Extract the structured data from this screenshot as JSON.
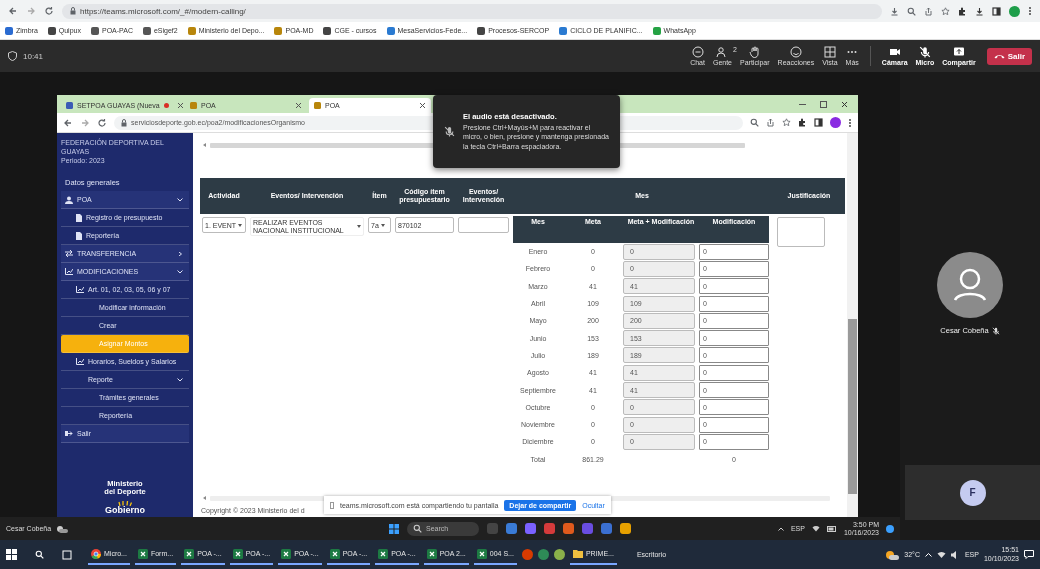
{
  "browser": {
    "url": "https://teams.microsoft.com/_#/modern-calling/",
    "bookmarks": [
      "Zimbra",
      "Quipux",
      "POA-PAC",
      "eSigef2",
      "Ministerio del Depo...",
      "POA-MD",
      "CGE - cursos",
      "MesaServicios-Fede...",
      "Procesos-SERCOP",
      "CICLO DE PLANIFIC...",
      "WhatsApp"
    ]
  },
  "call_bar": {
    "timer": "10:41",
    "actions": [
      {
        "label": "Chat"
      },
      {
        "label": "Gente",
        "count": "2"
      },
      {
        "label": "Participar"
      },
      {
        "label": "Reacciones"
      },
      {
        "label": "Vista"
      },
      {
        "label": "Más"
      },
      {
        "label": "Cámara"
      },
      {
        "label": "Micro"
      },
      {
        "label": "Compartir"
      }
    ],
    "leave": "Salir"
  },
  "shared_screen": {
    "tabs": [
      {
        "label": "SETPOA GUAYAS (Nueva",
        "selected": false,
        "recording": true
      },
      {
        "label": "POA",
        "selected": false,
        "recording": false
      },
      {
        "label": "POA",
        "selected": true,
        "recording": false
      }
    ],
    "url": "serviciosdeporte.gob.ec/poa2/modificacionesOrganismo",
    "org": "FEDERACIÓN DEPORTIVA DEL GUAYAS",
    "period": "Periodo: 2023",
    "nav": [
      {
        "label": "Datos generales",
        "kind": "heading",
        "selected": false
      },
      {
        "label": "POA",
        "kind": "user",
        "selected": false,
        "expanded": true,
        "children": [
          {
            "label": "Registro de presupuesto",
            "kind": "doc",
            "selected": false
          },
          {
            "label": "Reportería",
            "kind": "doc",
            "selected": false
          }
        ]
      },
      {
        "label": "TRANSFERENCIA",
        "kind": "swap",
        "selected": false,
        "expanded": false
      },
      {
        "label": "MODIFICACIONES",
        "kind": "chart",
        "selected": false,
        "expanded": true,
        "children": [
          {
            "label": "Art. 01, 02, 03, 05, 06 y 07",
            "kind": "chart",
            "selected": false,
            "children": [
              {
                "label": "Modificar información",
                "kind": "plain",
                "selected": false
              },
              {
                "label": "Crear",
                "kind": "plain",
                "selected": false
              },
              {
                "label": "Asignar Montos",
                "kind": "plain",
                "selected": true
              }
            ]
          },
          {
            "label": "Horarios, Sueldos y Salarios",
            "kind": "chart",
            "selected": false
          },
          {
            "label": "Reporte",
            "kind": "plain",
            "selected": false,
            "expanded": true,
            "children": [
              {
                "label": "Trámites generales",
                "kind": "plain",
                "selected": false
              },
              {
                "label": "Reportería",
                "kind": "plain",
                "selected": false
              }
            ]
          }
        ]
      },
      {
        "label": "Salir",
        "kind": "exit",
        "selected": false
      }
    ],
    "logo": {
      "line1": "Ministerio",
      "line2": "del Deporte",
      "brand": "Gobierno"
    },
    "table": {
      "columns": [
        "Actividad",
        "Eventos/ Intervención",
        "Ítem",
        "Código ítem presupuestario",
        "Eventos/ Intervención",
        "Mes",
        "Justificación"
      ],
      "row": {
        "activity": "1. EVENT",
        "event": "REALIZAR EVENTOS NACIONAL INSTITUCIONAL",
        "item": "7a",
        "code": "870102"
      },
      "month_columns": [
        "Mes",
        "Meta",
        "Meta + Modificación",
        "Modificación"
      ],
      "months": [
        {
          "name": "Enero",
          "meta": "0",
          "meta_mod": "0",
          "mod": "0"
        },
        {
          "name": "Febrero",
          "meta": "0",
          "meta_mod": "0",
          "mod": "0"
        },
        {
          "name": "Marzo",
          "meta": "41",
          "meta_mod": "41",
          "mod": "0"
        },
        {
          "name": "Abril",
          "meta": "109",
          "meta_mod": "109",
          "mod": "0"
        },
        {
          "name": "Mayo",
          "meta": "200",
          "meta_mod": "200",
          "mod": "0"
        },
        {
          "name": "Junio",
          "meta": "153",
          "meta_mod": "153",
          "mod": "0"
        },
        {
          "name": "Julio",
          "meta": "189",
          "meta_mod": "189",
          "mod": "0"
        },
        {
          "name": "Agosto",
          "meta": "41",
          "meta_mod": "41",
          "mod": "0"
        },
        {
          "name": "Septiembre",
          "meta": "41",
          "meta_mod": "41",
          "mod": "0"
        },
        {
          "name": "Octubre",
          "meta": "0",
          "meta_mod": "0",
          "mod": "0"
        },
        {
          "name": "Noviembre",
          "meta": "0",
          "meta_mod": "0",
          "mod": "0"
        },
        {
          "name": "Diciembre",
          "meta": "0",
          "meta_mod": "0",
          "mod": "0"
        }
      ],
      "total": {
        "label": "Total",
        "meta": "861.29",
        "mod": "0"
      }
    },
    "footer": "Copyright © 2023 Ministerio del d",
    "share_bar": {
      "message": "teams.microsoft.com está compartiendo tu pantalla",
      "stop": "Dejar de compartir",
      "hide": "Ocultar"
    },
    "presenter": "Cesar Cobeña",
    "taskbar": {
      "search": "Search",
      "tray": "ESP",
      "time": "3:50 PM",
      "date": "10/16/2023"
    }
  },
  "audio_toast": {
    "title": "El audio está desactivado.",
    "body": "Presione Ctrl+Mayús+M para reactivar el micro, o bien, presione y mantenga presionada la tecla Ctrl+Barra espaciadora."
  },
  "participant": {
    "name": "Cesar Cobeña"
  },
  "self_tile": {
    "initial": "F"
  },
  "taskbar": {
    "apps": [
      {
        "label": "Micro...",
        "kind": "chrome"
      },
      {
        "label": "Form...",
        "kind": "excel"
      },
      {
        "label": "POA -...",
        "kind": "excel"
      },
      {
        "label": "POA -...",
        "kind": "excel"
      },
      {
        "label": "POA -...",
        "kind": "excel"
      },
      {
        "label": "POA -...",
        "kind": "excel"
      },
      {
        "label": "POA -...",
        "kind": "excel"
      },
      {
        "label": "POA 2...",
        "kind": "excel"
      },
      {
        "label": "004 S...",
        "kind": "excel"
      },
      {
        "label": "PRIME...",
        "kind": "folder"
      }
    ],
    "toolbar": "Escritorio",
    "weather": "32°C",
    "lang": "ESP",
    "time": "15:51",
    "date": "10/10/2023"
  }
}
